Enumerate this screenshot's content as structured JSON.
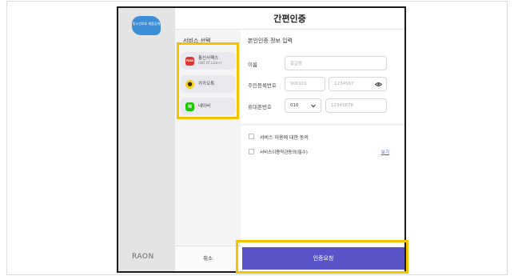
{
  "modal": {
    "title": "간편인증",
    "logo_text": "청소년보호 재품공계",
    "brand": "RAON",
    "cancel_label": "취소",
    "confirm_label": "인증요청"
  },
  "services": {
    "title": "서비스 선택",
    "items": [
      {
        "name": "통신사패스",
        "sub": "(SKT,KT,LGU+)",
        "icon_text": "PASS",
        "color": "#e8322e"
      },
      {
        "name": "카카오톡",
        "icon_text": "●",
        "color": "#f7d21e"
      },
      {
        "name": "네이버",
        "icon_text": "N",
        "color": "#1ec800"
      }
    ]
  },
  "form": {
    "title": "본인인증 정보 입력",
    "name_label": "이름",
    "name_placeholder": "홍길동",
    "rrn_label": "주민등록번호",
    "rrn_front_placeholder": "900101",
    "rrn_back_placeholder": "1234567",
    "phone_label": "휴대폰번호",
    "carrier_value": "010",
    "phone_placeholder": "12345678"
  },
  "agreement": {
    "all_label": "서비스 이용에 대한 동의",
    "terms_label": "서비스이용약관동의(필수)",
    "view_label": "보기"
  }
}
